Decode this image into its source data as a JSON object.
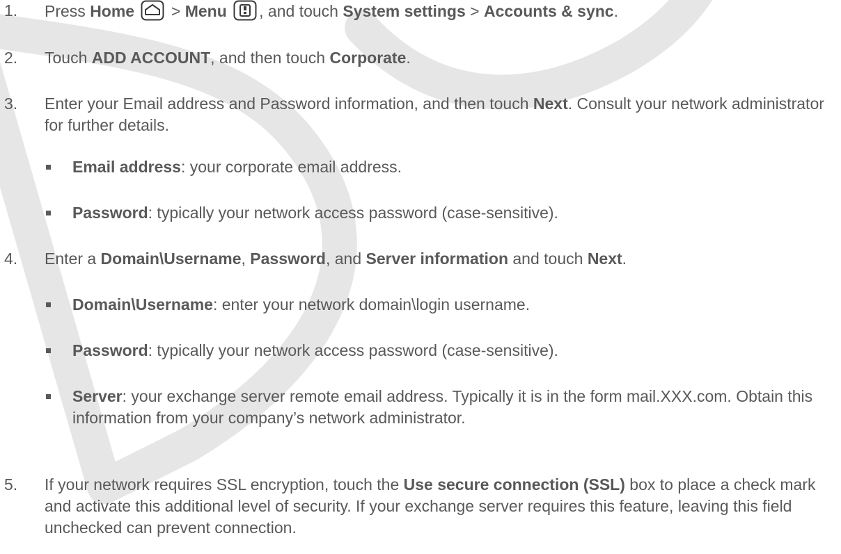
{
  "watermark": {
    "color": "#e6e6e6"
  },
  "steps": [
    {
      "number": "1.",
      "t1": "Press ",
      "b1": "Home",
      "t2": " > ",
      "b2": "Menu",
      "t3": ", and touch ",
      "b3": "System settings",
      "t4": " > ",
      "b4": "Accounts & sync",
      "t5": "."
    },
    {
      "number": "2.",
      "t1": "Touch ",
      "b1": "ADD ACCOUNT",
      "t2": ", and then touch ",
      "b2": "Corporate",
      "t3": "."
    },
    {
      "number": "3.",
      "t1": "Enter your Email address and Password information, and then touch ",
      "b1": "Next",
      "t2": ". Consult your network administrator for further details.",
      "bullets": [
        {
          "b": "Email address",
          "t": ": your corporate email address."
        },
        {
          "b": "Password",
          "t": ": typically your network access password (case-sensitive)."
        }
      ]
    },
    {
      "number": "4.",
      "t1": "Enter a ",
      "b1": "Domain\\Username",
      "t2": ", ",
      "b2": "Password",
      "t3": ", and ",
      "b3": "Server information",
      "t4": " and touch ",
      "b4": "Next",
      "t5": ".",
      "bullets": [
        {
          "b": "Domain\\Username",
          "t": ": enter your network domain\\login username."
        },
        {
          "b": "Password",
          "t": ": typically your network access password (case-sensitive)."
        },
        {
          "b": "Server",
          "t": ": your exchange server remote email address. Typically it is in the form mail.XXX.com. Obtain this information from your company’s network administrator."
        }
      ]
    },
    {
      "number": "5.",
      "t1": "If your network requires SSL encryption, touch the ",
      "b1": "Use secure connection (SSL)",
      "t2": " box to place a check mark and activate this additional level of security. If your exchange server requires this feature, leaving this field unchecked can prevent connection."
    }
  ],
  "icons": {
    "home": "home-key-icon",
    "menu": "menu-key-icon"
  }
}
